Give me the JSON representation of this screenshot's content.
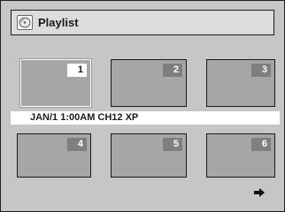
{
  "header": {
    "title": "Playlist",
    "icon": "disc-icon"
  },
  "thumbnails": [
    {
      "number": "1",
      "selected": true
    },
    {
      "number": "2",
      "selected": false
    },
    {
      "number": "3",
      "selected": false
    },
    {
      "number": "4",
      "selected": false
    },
    {
      "number": "5",
      "selected": false
    },
    {
      "number": "6",
      "selected": false
    }
  ],
  "info": {
    "text": "JAN/1 1:00AM CH12 XP"
  },
  "navigation": {
    "next_icon": "arrow-right-icon"
  },
  "colors": {
    "background": "#c6c6c6",
    "thumbnail": "#a6a6a6",
    "number_badge": "#7f7f7f",
    "selected_badge": "#ffffff"
  }
}
